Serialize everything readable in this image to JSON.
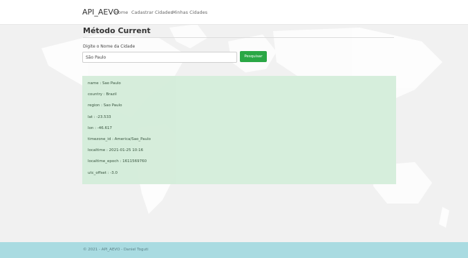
{
  "nav": {
    "brand": "API_AEVO",
    "links": [
      "Home",
      "Cadastrar Cidades",
      "Minhas Cidades"
    ]
  },
  "page": {
    "title": "Método Current",
    "field_label": "Digite o Nome da Cidade",
    "input_value": "São Paulo",
    "search_label": "Pesquisar"
  },
  "result": {
    "lines": [
      "name : Sao Paulo",
      "country : Brazil",
      "region : Sao Paulo",
      "lat : -23.533",
      "lon : -46.617",
      "timezone_id : America/Sao_Paulo",
      "localtime : 2021-01-25 10:16",
      "localtime_epoch : 1611569760",
      "utc_offset : -3.0"
    ]
  },
  "footer": {
    "text": "© 2021 - API_AEVO - Daniel Toguti"
  },
  "colors": {
    "search_button": "#2aa745",
    "result_panel": "#d4edda",
    "footer": "#a9dbe1"
  }
}
